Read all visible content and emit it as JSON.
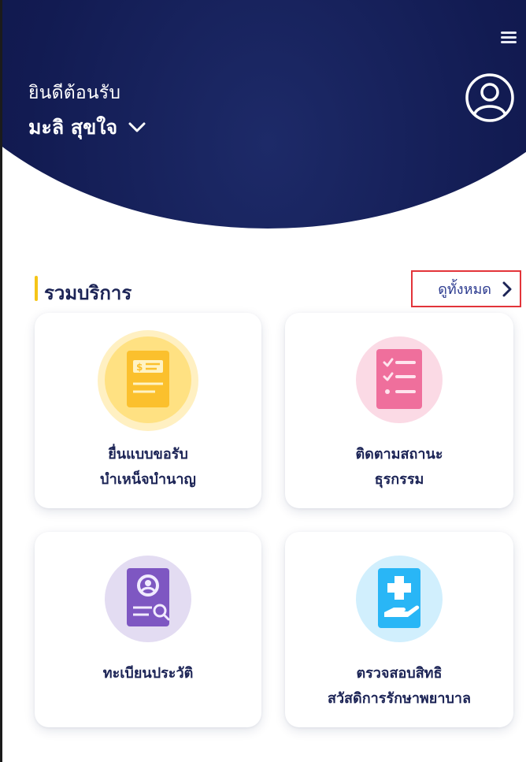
{
  "header": {
    "welcome_text": "ยินดีต้อนรับ",
    "user_name": "มะลิ สุขใจ",
    "menu_icon": "hamburger-menu-icon",
    "avatar_icon": "user-circle-icon",
    "background_color": "#121b52"
  },
  "services": {
    "section_title": "รวมบริการ",
    "view_all_label": "ดูทั้งหมด",
    "accent_color": "#f5c518",
    "highlight_color": "#e3343a",
    "items": [
      {
        "label_line1": "ยื่นแบบขอรับ",
        "label_line2": "บำเหน็จบำนาญ",
        "icon": "document-money-icon",
        "color": "#fbc02d"
      },
      {
        "label_line1": "ติดตามสถานะ",
        "label_line2": "ธุรกรรม",
        "icon": "checklist-icon",
        "color": "#ef6f9c"
      },
      {
        "label_line1": "ทะเบียนประวัติ",
        "label_line2": "",
        "icon": "profile-search-icon",
        "color": "#7e57c2"
      },
      {
        "label_line1": "ตรวจสอบสิทธิ",
        "label_line2": "สวัสดิการรักษาพยาบาล",
        "icon": "medical-hand-icon",
        "color": "#29b6f6"
      }
    ]
  }
}
